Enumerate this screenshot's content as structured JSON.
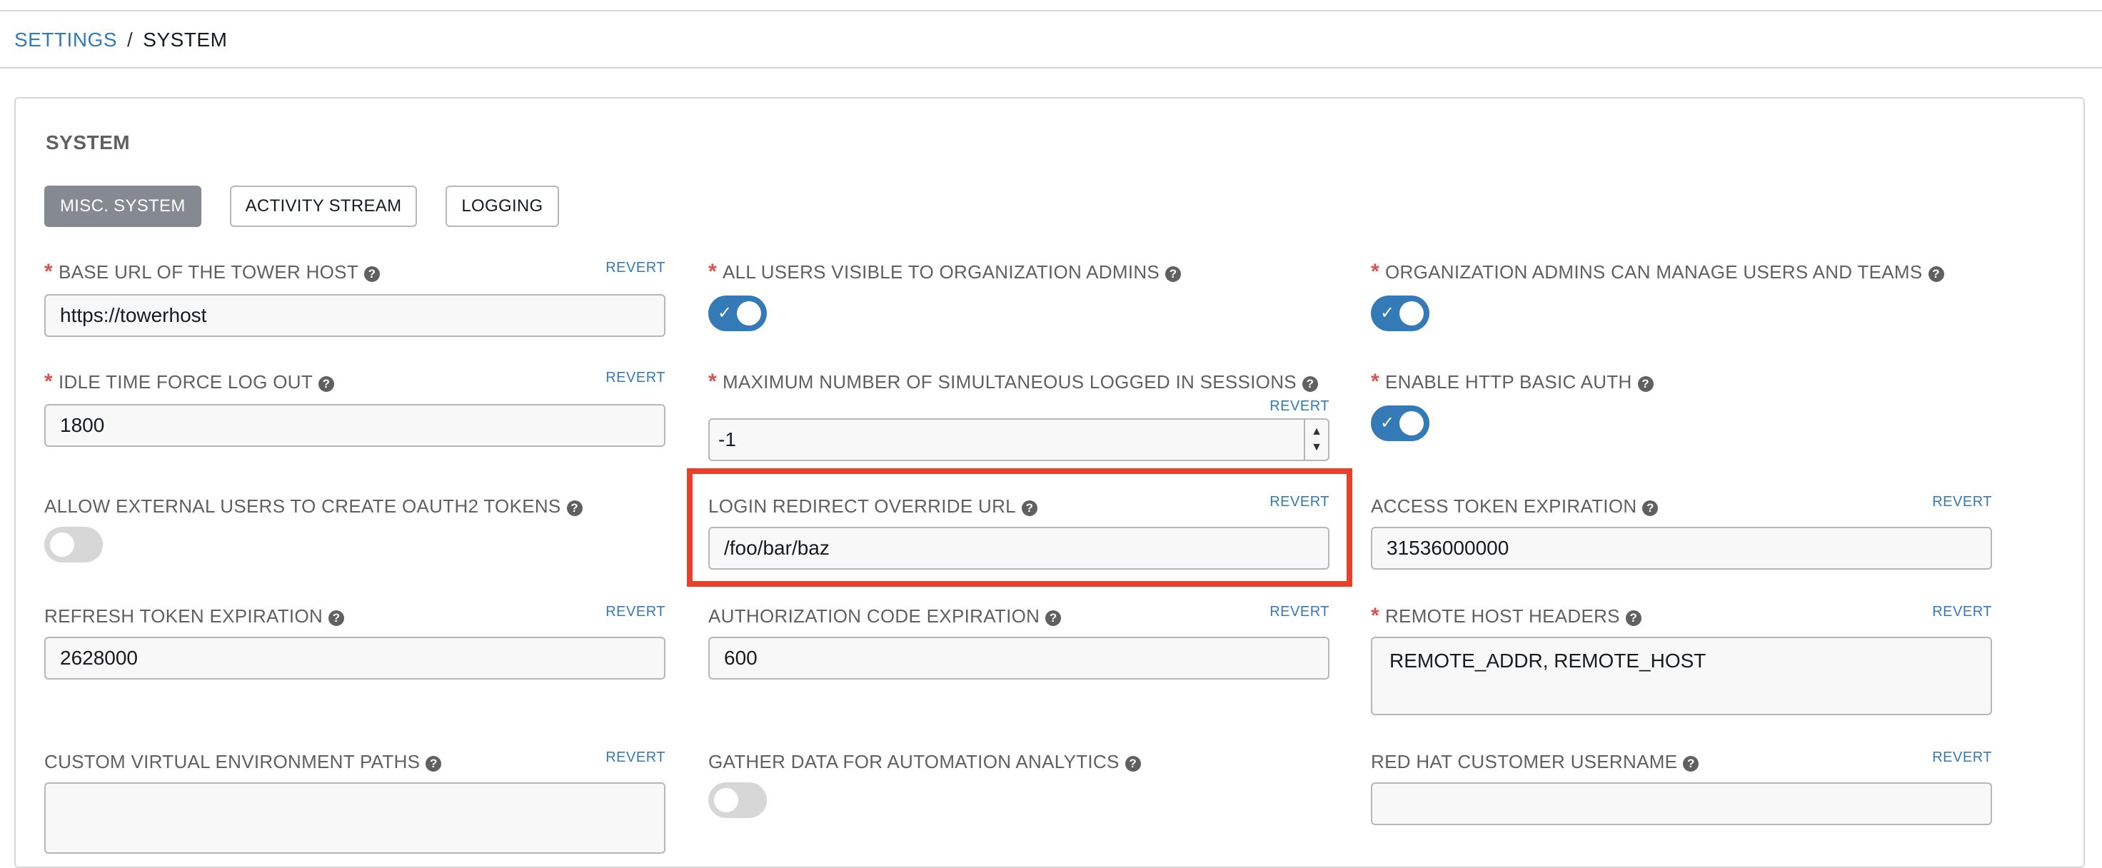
{
  "breadcrumb": {
    "parent": "SETTINGS",
    "separator": "/",
    "current": "SYSTEM"
  },
  "panel": {
    "title": "SYSTEM",
    "tabs": [
      {
        "label": "MISC. SYSTEM",
        "active": true
      },
      {
        "label": "ACTIVITY STREAM",
        "active": false
      },
      {
        "label": "LOGGING",
        "active": false
      }
    ]
  },
  "revert_label": "REVERT",
  "fields": {
    "base_url": {
      "label": "BASE URL OF THE TOWER HOST",
      "required": true,
      "value": "https://towerhost"
    },
    "all_users_visible": {
      "label": "ALL USERS VISIBLE TO ORGANIZATION ADMINS",
      "required": true,
      "toggle": "on"
    },
    "org_admins_manage": {
      "label": "ORGANIZATION ADMINS CAN MANAGE USERS AND TEAMS",
      "required": true,
      "toggle": "on"
    },
    "idle_timeout": {
      "label": "IDLE TIME FORCE LOG OUT",
      "required": true,
      "value": "1800"
    },
    "max_sessions": {
      "label": "MAXIMUM NUMBER OF SIMULTANEOUS LOGGED IN SESSIONS",
      "required": true,
      "value": "-1"
    },
    "http_basic_auth": {
      "label": "ENABLE HTTP BASIC AUTH",
      "required": true,
      "toggle": "on"
    },
    "allow_oauth2": {
      "label": "ALLOW EXTERNAL USERS TO CREATE OAUTH2 TOKENS",
      "required": false,
      "toggle": "off"
    },
    "login_redirect": {
      "label": "LOGIN REDIRECT OVERRIDE URL",
      "required": false,
      "value": "/foo/bar/baz"
    },
    "access_token": {
      "label": "ACCESS TOKEN EXPIRATION",
      "required": false,
      "value": "31536000000"
    },
    "refresh_token": {
      "label": "REFRESH TOKEN EXPIRATION",
      "required": false,
      "value": "2628000"
    },
    "auth_code": {
      "label": "AUTHORIZATION CODE EXPIRATION",
      "required": false,
      "value": "600"
    },
    "remote_host_headers": {
      "label": "REMOTE HOST HEADERS",
      "required": true,
      "value": "REMOTE_ADDR, REMOTE_HOST"
    },
    "custom_venv": {
      "label": "CUSTOM VIRTUAL ENVIRONMENT PATHS",
      "required": false,
      "value": ""
    },
    "gather_analytics": {
      "label": "GATHER DATA FOR AUTOMATION ANALYTICS",
      "required": false,
      "toggle": "off"
    },
    "rh_username": {
      "label": "RED HAT CUSTOMER USERNAME",
      "required": false,
      "value": ""
    }
  },
  "colors": {
    "link": "#337ab7",
    "toggle_on": "#337ab7",
    "toggle_off": "#d7d7d7",
    "required": "#d9534f",
    "highlight": "#e8402a",
    "active_tab": "#848992"
  }
}
